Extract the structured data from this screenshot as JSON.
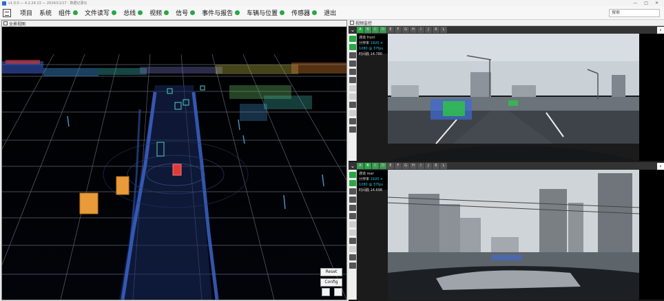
{
  "window": {
    "title": "v1.0.0 — 4.2.24.13 — 2024/11/17 · 数据记录仪"
  },
  "menu": {
    "items": [
      {
        "label": "项目",
        "status": false
      },
      {
        "label": "系统",
        "status": false
      },
      {
        "label": "组件",
        "status": true
      },
      {
        "label": "文件读写",
        "status": true
      },
      {
        "label": "总线",
        "status": true
      },
      {
        "label": "视频",
        "status": true
      },
      {
        "label": "信号",
        "status": true
      },
      {
        "label": "事件与报告",
        "status": true
      },
      {
        "label": "车辆与位置",
        "status": true
      },
      {
        "label": "传感器",
        "status": true
      },
      {
        "label": "退出",
        "status": false
      }
    ],
    "search_placeholder": "搜索",
    "status_color": "#27a844"
  },
  "view3d": {
    "header": "全景视图",
    "reset_label": "Reset",
    "config_label": "Config",
    "object_color": "#e99b3a",
    "ego_color": "#e03b3b"
  },
  "video": {
    "header": "视频监控",
    "tab_labels": [
      "A",
      "B",
      "C",
      "D",
      "E",
      "F",
      "G",
      "H",
      "I",
      "J",
      "K",
      "L"
    ],
    "cameras": [
      {
        "label_channel": "通道",
        "channel": "front",
        "label_res": "分辨率",
        "resolution": "1920 × 1080 @ 37fps",
        "label_time": "时间戳",
        "timestamp": "14.780"
      },
      {
        "label_channel": "通道",
        "channel": "rear",
        "label_res": "分辨率",
        "resolution": "1920 × 1080 @ 37fps",
        "label_time": "时间戳",
        "timestamp": "14.698"
      }
    ]
  }
}
